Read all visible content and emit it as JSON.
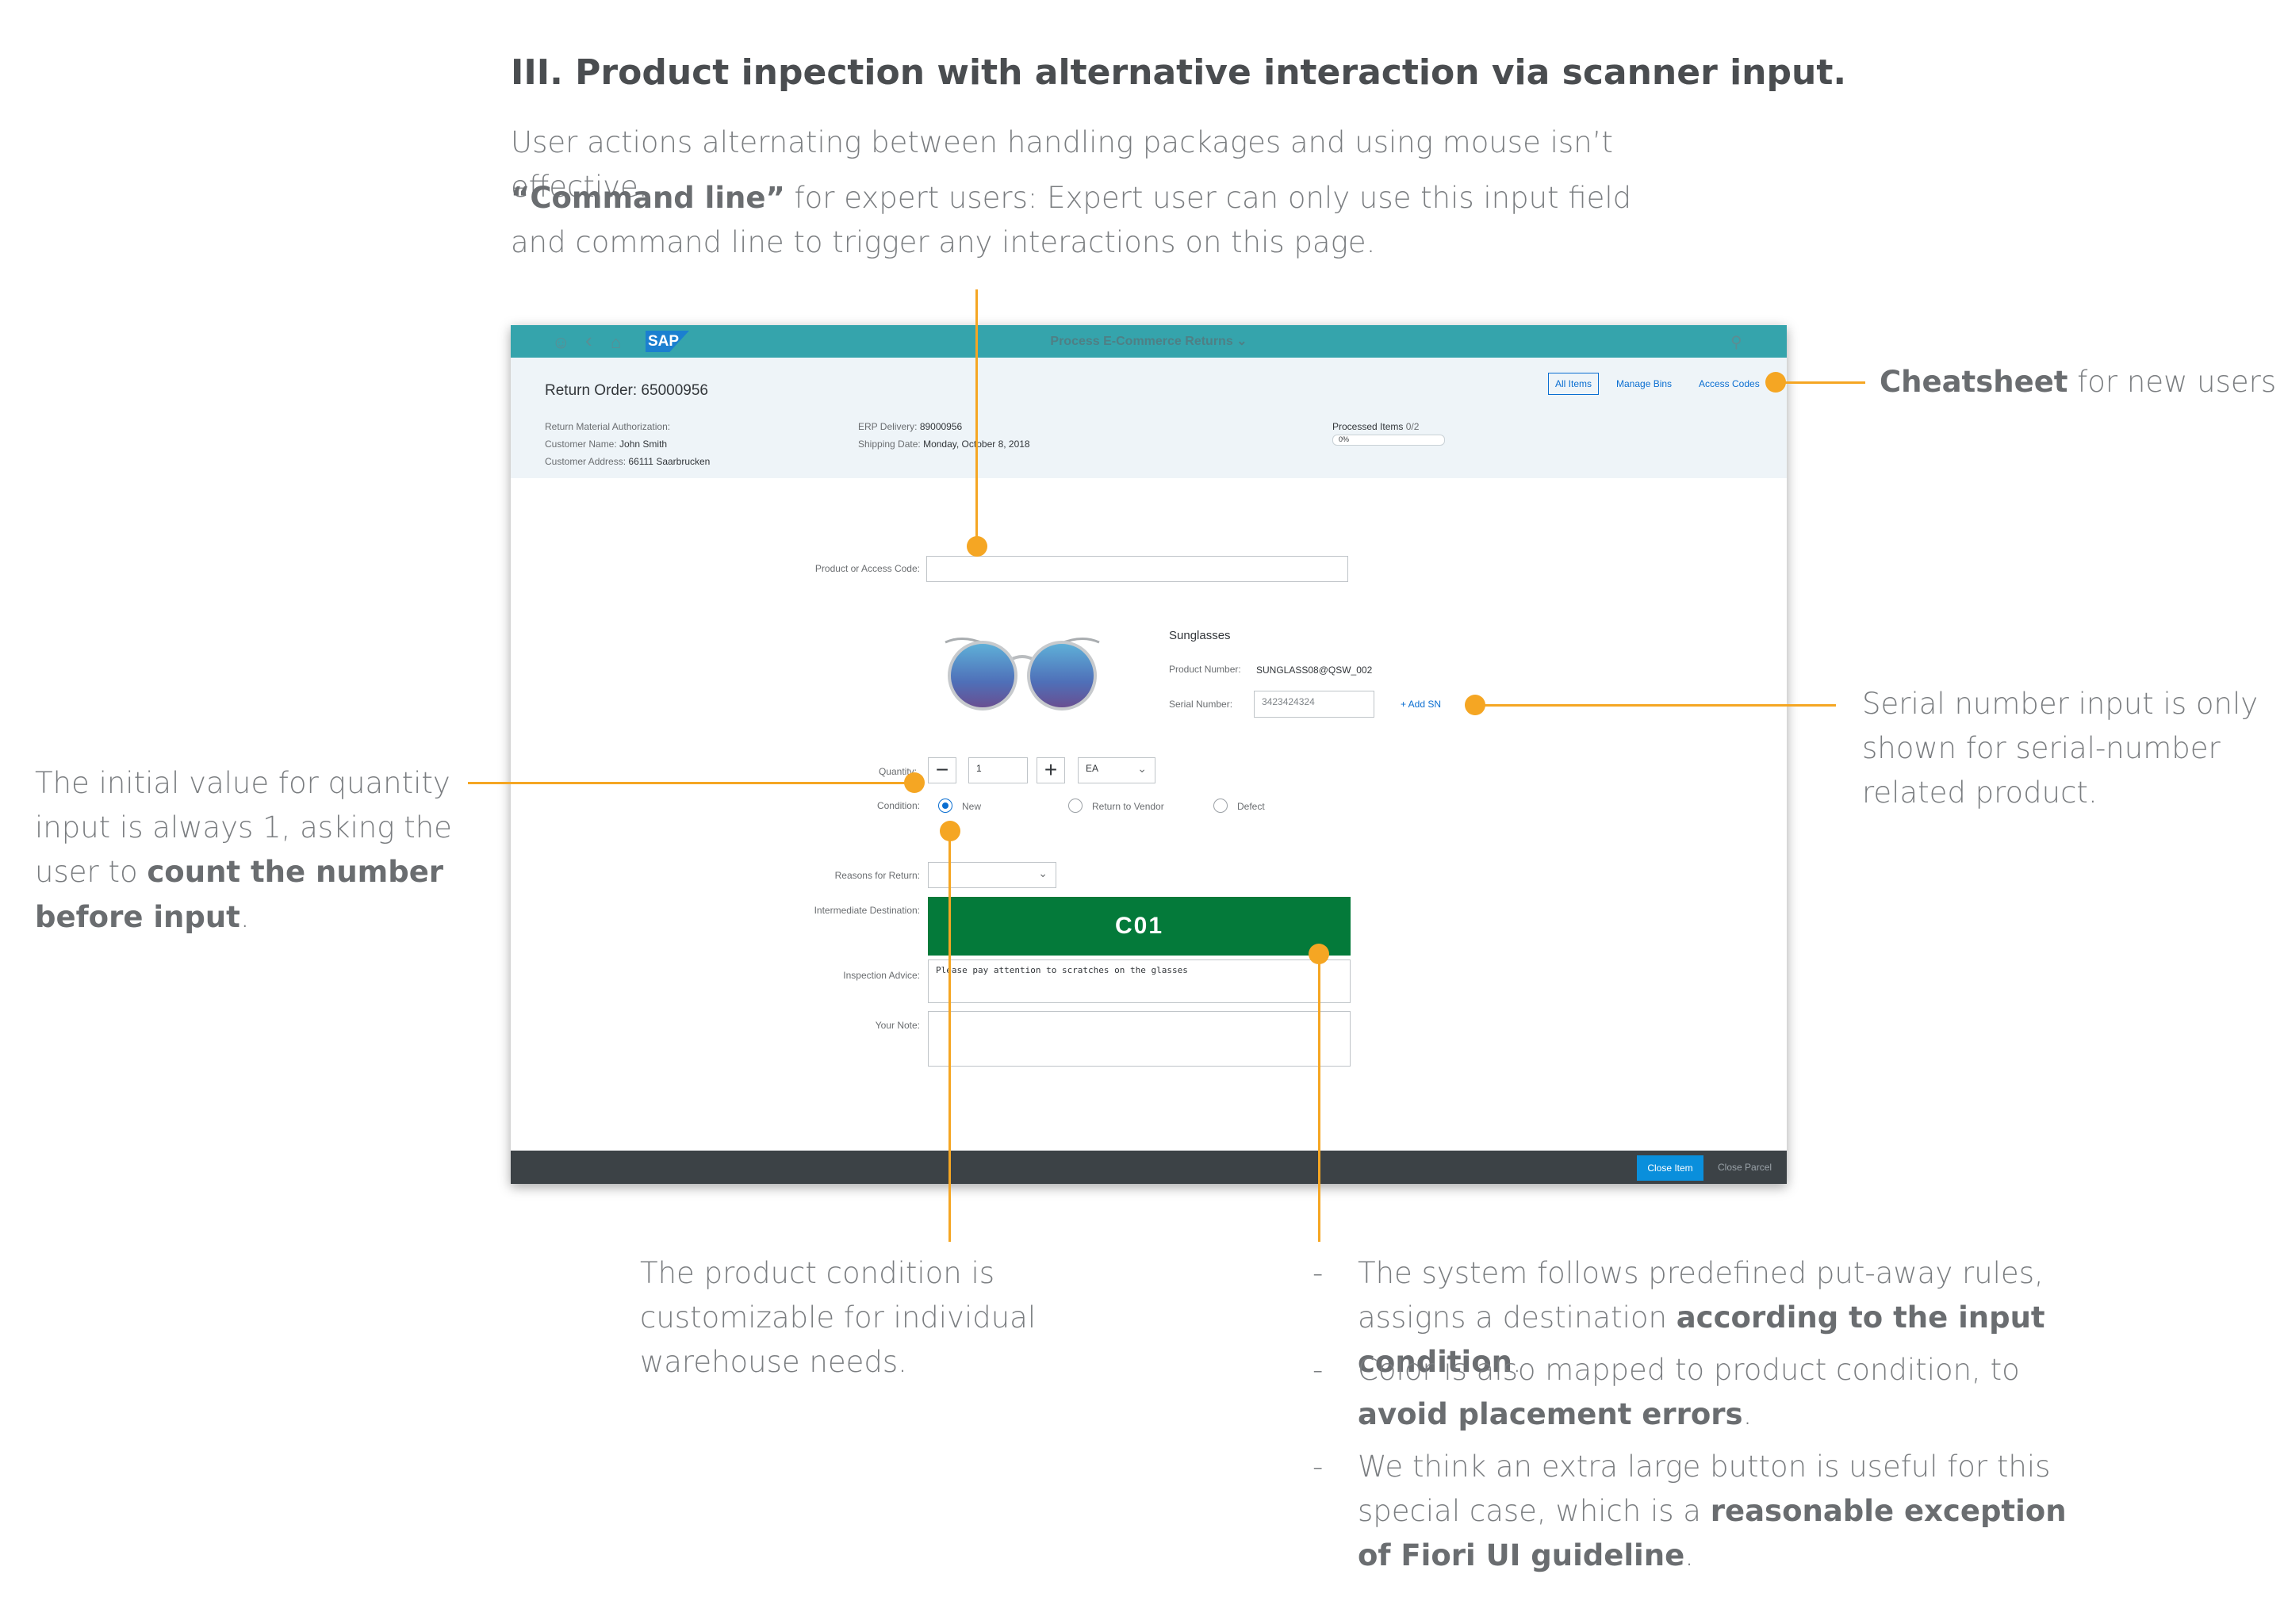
{
  "doc": {
    "title": "III. Product inpection with alternative interaction via scanner input.",
    "intro_line1": "User actions alternating between handling packages and using mouse isn’t effective.",
    "intro_cmd_bold": "“Command line”",
    "intro_cmd_rest": " for expert users: Expert user can only use this input field and command line to trigger any interactions on this page."
  },
  "shell": {
    "logo": "SAP",
    "title": "Process E-Commerce Returns"
  },
  "header": {
    "order_title": "Return Order: 65000956",
    "rma_label": "Return Material Authorization:",
    "rma_value": "",
    "customer_name_label": "Customer Name:",
    "customer_name_value": "John Smith",
    "customer_address_label": "Customer Address:",
    "customer_address_value": "66111 Saarbrucken",
    "erp_label": "ERP Delivery:",
    "erp_value": "89000956",
    "shipping_label": "Shipping Date:",
    "shipping_value": "Monday, October 8, 2018",
    "processed_label": "Processed Items",
    "processed_value": "0/2",
    "progress_text": "0%",
    "progress": 0,
    "tabs": [
      "All Items",
      "Manage Bins",
      "Access Codes"
    ]
  },
  "form": {
    "code_label": "Product or Access Code:",
    "code_value": "",
    "product_name": "Sunglasses",
    "product_number_label": "Product Number:",
    "product_number_value": "SUNGLASS08@QSW_002",
    "serial_label": "Serial Number:",
    "serial_value": "3423424324",
    "add_sn": "+ Add SN",
    "quantity_label": "Quantity:",
    "quantity_value": "1",
    "unit_value": "EA",
    "condition_label": "Condition:",
    "conditions": [
      "New",
      "Return to Vendor",
      "Defect"
    ],
    "selected_condition": "New",
    "reasons_label": "Reasons for Return:",
    "reasons_value": "",
    "destination_label": "Intermediate Destination:",
    "destination_value": "C01",
    "advice_label": "Inspection Advice:",
    "advice_value": "Please pay attention to scratches on the glasses",
    "note_label": "Your Note:",
    "note_value": ""
  },
  "footer": {
    "close_item": "Close Item",
    "close_parcel": "Close Parcel"
  },
  "callouts": {
    "cheatsheet_bold": "Cheatsheet",
    "cheatsheet_rest": " for new users",
    "serial": "Serial number input is only shown for serial-number related product.",
    "qty_pre": "The initial value for quantity input is always 1, asking the user to ",
    "qty_bold": "count the number before input",
    "qty_post": ".",
    "condition": "The product condition is customizable for individual warehouse needs.",
    "bullet1_pre": "The system follows predefined put-away rules, assigns a destination ",
    "bullet1_bold": "according to the input condition",
    "bullet1_post": ".",
    "bullet2_pre": "Color is also mapped to product condition, to ",
    "bullet2_bold": "avoid placement errors",
    "bullet2_post": ".",
    "bullet3_pre": "We think an extra large button is useful for this special case, which is a ",
    "bullet3_bold": "reasonable exception of Fiori UI guideline",
    "bullet3_post": ".",
    "bullet_dash": "-"
  },
  "colors": {
    "shell": "#35a4ac",
    "accent": "#f5a623",
    "destination": "#047a3a",
    "primary_button": "#0a8fdc"
  }
}
